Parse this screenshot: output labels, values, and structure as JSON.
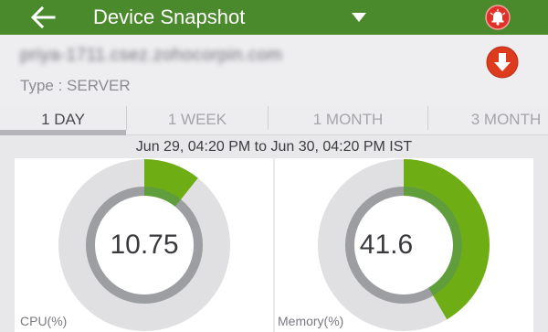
{
  "appbar": {
    "title": "Device Snapshot",
    "back_icon": "arrow-left-icon",
    "dropdown_icon": "caret-down-icon",
    "alarm_icon": "alarm-bell-icon",
    "color": "#4a8a2c"
  },
  "device": {
    "name": "priya-1711.csez.zohocorpin.com",
    "type_label": "Type : SERVER",
    "download_icon": "download-arrow-icon"
  },
  "tabs": [
    {
      "label": "1 DAY",
      "active": true
    },
    {
      "label": "1 WEEK",
      "active": false
    },
    {
      "label": "1 MONTH",
      "active": false
    },
    {
      "label": "3 MONTH",
      "active": false
    }
  ],
  "date_range": "Jun 29, 04:20 PM to Jun 30, 04:20 PM IST",
  "gauges": [
    {
      "label": "CPU(%)",
      "value_text": "10.75",
      "percent": 10.75,
      "color": "#6fad14"
    },
    {
      "label": "Memory(%)",
      "value_text": "41.6",
      "percent": 41.6,
      "color": "#6fad14"
    }
  ],
  "colors": {
    "gauge_track": "#e0e0e3",
    "gauge_inner": "#9c9ea1",
    "alarm_red": "#e0302a"
  }
}
